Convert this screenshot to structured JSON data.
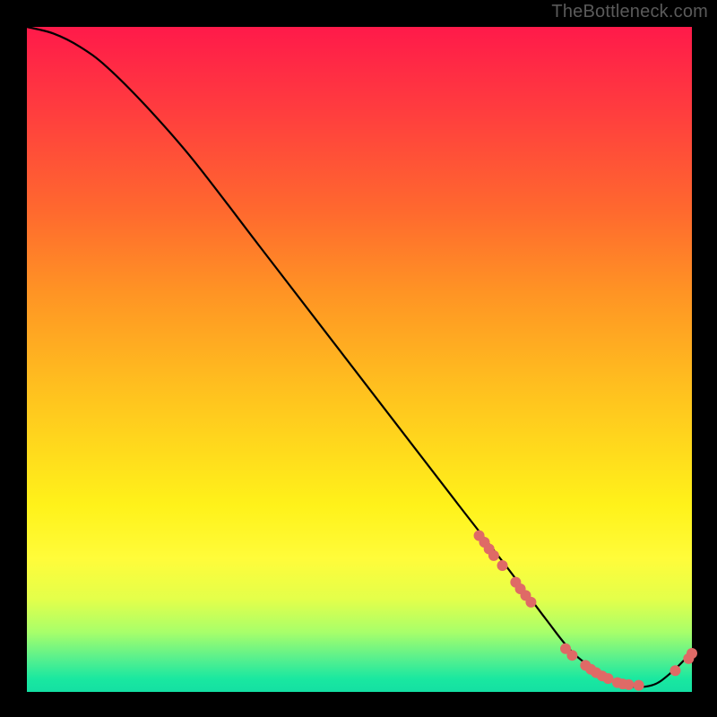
{
  "watermark": "TheBottleneck.com",
  "chart_data": {
    "type": "line",
    "title": "",
    "xlabel": "",
    "ylabel": "",
    "xlim": [
      0,
      100
    ],
    "ylim": [
      0,
      100
    ],
    "series": [
      {
        "name": "curve",
        "x": [
          0,
          4,
          8,
          12,
          18,
          25,
          35,
          45,
          55,
          65,
          72,
          78,
          82,
          86,
          90,
          94,
          97,
          100
        ],
        "y": [
          100,
          99,
          97,
          94,
          88,
          80,
          67,
          54,
          41,
          28,
          19,
          11,
          6,
          3,
          1,
          1,
          3,
          6
        ]
      }
    ],
    "markers": [
      {
        "x": 68.0,
        "y": 23.5
      },
      {
        "x": 68.8,
        "y": 22.5
      },
      {
        "x": 69.5,
        "y": 21.5
      },
      {
        "x": 70.2,
        "y": 20.5
      },
      {
        "x": 71.5,
        "y": 19.0
      },
      {
        "x": 73.5,
        "y": 16.5
      },
      {
        "x": 74.2,
        "y": 15.5
      },
      {
        "x": 75.0,
        "y": 14.5
      },
      {
        "x": 75.8,
        "y": 13.5
      },
      {
        "x": 81.0,
        "y": 6.5
      },
      {
        "x": 82.0,
        "y": 5.5
      },
      {
        "x": 84.0,
        "y": 4.0
      },
      {
        "x": 84.8,
        "y": 3.4
      },
      {
        "x": 85.6,
        "y": 2.9
      },
      {
        "x": 86.5,
        "y": 2.4
      },
      {
        "x": 87.4,
        "y": 2.0
      },
      {
        "x": 88.8,
        "y": 1.4
      },
      {
        "x": 89.6,
        "y": 1.2
      },
      {
        "x": 90.5,
        "y": 1.1
      },
      {
        "x": 92.0,
        "y": 1.0
      },
      {
        "x": 97.5,
        "y": 3.2
      },
      {
        "x": 99.5,
        "y": 5.0
      },
      {
        "x": 100.0,
        "y": 5.8
      }
    ],
    "colors": {
      "line": "#000000",
      "marker": "#df6a66"
    }
  }
}
